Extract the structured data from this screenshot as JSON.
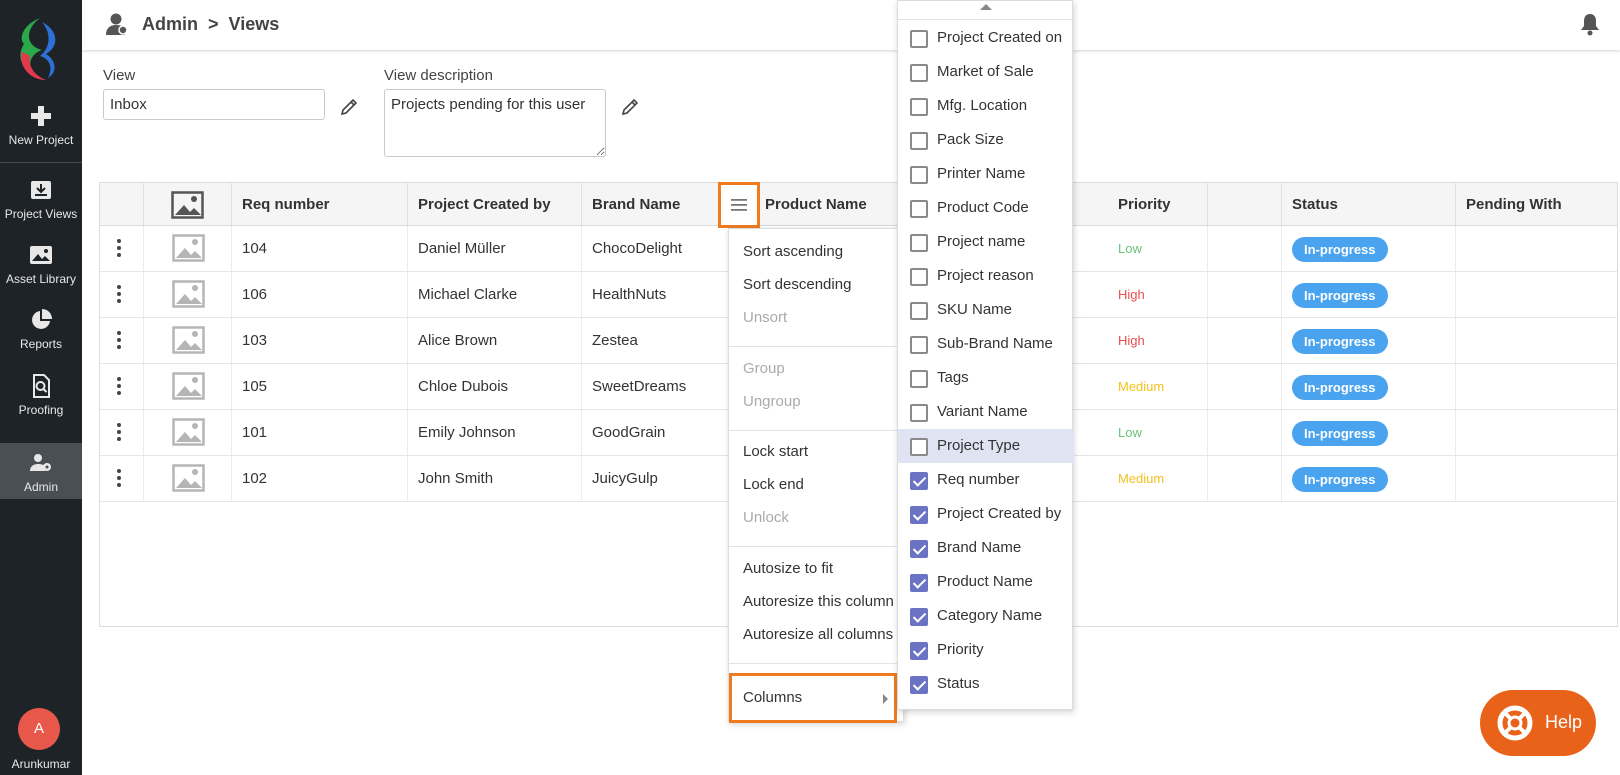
{
  "sidebar": {
    "items": [
      {
        "label": "New Project",
        "icon": "plus-icon"
      },
      {
        "label": "Project Views",
        "icon": "inbox-download-icon"
      },
      {
        "label": "Asset Library",
        "icon": "image-icon"
      },
      {
        "label": "Reports",
        "icon": "pie-chart-icon"
      },
      {
        "label": "Proofing",
        "icon": "proof-document-icon"
      },
      {
        "label": "Admin",
        "icon": "admin-user-icon"
      }
    ],
    "user_initial": "A",
    "user_name": "Arunkumar"
  },
  "header": {
    "crumb_root": "Admin",
    "crumb_sep": ">",
    "crumb_current": "Views"
  },
  "form": {
    "view_label": "View",
    "view_value": "Inbox",
    "desc_label": "View description",
    "desc_value": "Projects pending for this user"
  },
  "grid": {
    "columns": [
      "",
      "",
      "Req number",
      "Project Created by",
      "Brand Name",
      "Product Name",
      "Priority",
      "Status",
      "Pending With"
    ],
    "rows": [
      {
        "req": "104",
        "created_by": "Daniel Müller",
        "brand": "ChocoDelight",
        "priority": "Low",
        "status": "In-progress"
      },
      {
        "req": "106",
        "created_by": "Michael Clarke",
        "brand": "HealthNuts",
        "priority": "High",
        "status": "In-progress"
      },
      {
        "req": "103",
        "created_by": "Alice Brown",
        "brand": "Zestea",
        "priority": "High",
        "status": "In-progress"
      },
      {
        "req": "105",
        "created_by": "Chloe Dubois",
        "brand": "SweetDreams",
        "priority": "Medium",
        "status": "In-progress"
      },
      {
        "req": "101",
        "created_by": "Emily Johnson",
        "brand": "GoodGrain",
        "priority": "Low",
        "status": "In-progress"
      },
      {
        "req": "102",
        "created_by": "John Smith",
        "brand": "JuicyGulp",
        "priority": "Medium",
        "status": "In-progress"
      }
    ]
  },
  "column_menu": {
    "sort_asc": "Sort ascending",
    "sort_desc": "Sort descending",
    "unsort": "Unsort",
    "group": "Group",
    "ungroup": "Ungroup",
    "lock_start": "Lock start",
    "lock_end": "Lock end",
    "unlock": "Unlock",
    "autosize_fit": "Autosize to fit",
    "autoresize_this": "Autoresize this column",
    "autoresize_all": "Autoresize all columns",
    "columns": "Columns"
  },
  "column_chooser": {
    "options": [
      {
        "label": "Project Created on",
        "checked": false
      },
      {
        "label": "Market of Sale",
        "checked": false
      },
      {
        "label": "Mfg. Location",
        "checked": false
      },
      {
        "label": "Pack Size",
        "checked": false
      },
      {
        "label": "Printer Name",
        "checked": false
      },
      {
        "label": "Product Code",
        "checked": false
      },
      {
        "label": "Project name",
        "checked": false
      },
      {
        "label": "Project reason",
        "checked": false
      },
      {
        "label": "SKU Name",
        "checked": false
      },
      {
        "label": "Sub-Brand Name",
        "checked": false
      },
      {
        "label": "Tags",
        "checked": false
      },
      {
        "label": "Variant Name",
        "checked": false
      },
      {
        "label": "Project Type",
        "checked": false
      },
      {
        "label": "Req number",
        "checked": true
      },
      {
        "label": "Project Created by",
        "checked": true
      },
      {
        "label": "Brand Name",
        "checked": true
      },
      {
        "label": "Product Name",
        "checked": true
      },
      {
        "label": "Category Name",
        "checked": true
      },
      {
        "label": "Priority",
        "checked": true
      },
      {
        "label": "Status",
        "checked": true
      }
    ]
  },
  "help": {
    "label": "Help"
  },
  "colors": {
    "accent_orange": "#f07b1f",
    "badge_blue": "#4aa3ee",
    "priority_low": "#6cc07a",
    "priority_high": "#ea4d4d",
    "priority_medium": "#f1c21b",
    "checkbox_on": "#6b74c4",
    "sidebar_bg": "#1e2327"
  }
}
